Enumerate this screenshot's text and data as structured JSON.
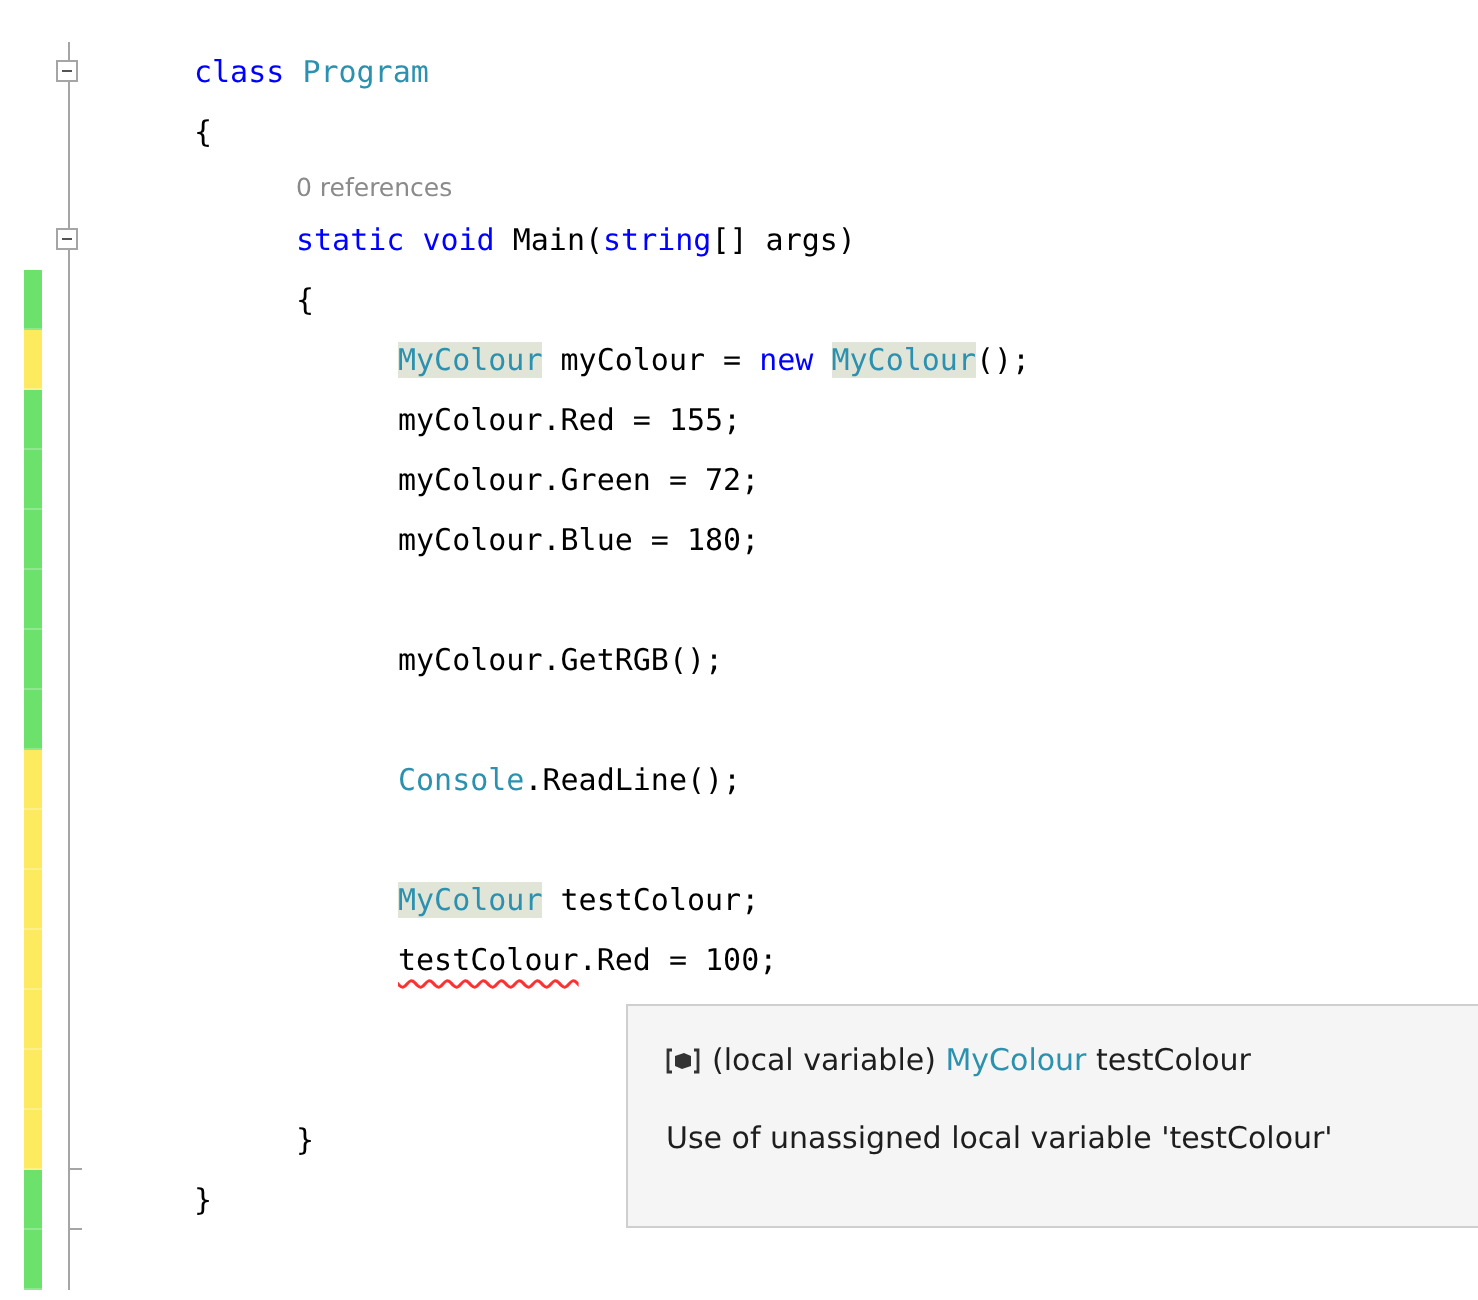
{
  "lines": [
    {
      "kind": "code",
      "expanded": true,
      "tokens": [
        {
          "kind": "keyword",
          "text": "class "
        },
        {
          "kind": "type",
          "text": "Program"
        }
      ]
    },
    {
      "kind": "code",
      "tokens": [
        {
          "kind": "plain",
          "text": "{"
        }
      ],
      "children": [
        {
          "kind": "codelens",
          "text": "0 references"
        },
        {
          "kind": "code",
          "expanded": true,
          "tokens": [
            {
              "kind": "keyword",
              "text": "static "
            },
            {
              "kind": "keyword",
              "text": "void"
            },
            {
              "kind": "plain",
              "text": " Main("
            },
            {
              "kind": "keyword",
              "text": "string"
            },
            {
              "kind": "plain",
              "text": "[] args)"
            }
          ]
        },
        {
          "kind": "code",
          "modified": false,
          "tokens": [
            {
              "kind": "plain",
              "text": "{"
            }
          ],
          "children": [
            {
              "kind": "code",
              "modified": true,
              "tokens": [
                {
                  "kind": "type_highlight",
                  "text": "MyColour"
                },
                {
                  "kind": "plain",
                  "text": " myColour = "
                },
                {
                  "kind": "keyword",
                  "text": "new "
                },
                {
                  "kind": "type_highlight",
                  "text": "MyColour"
                },
                {
                  "kind": "plain",
                  "text": "();"
                }
              ]
            },
            {
              "kind": "code",
              "modified": false,
              "tokens": [
                {
                  "kind": "plain",
                  "text": "myColour.Red = 155;"
                }
              ]
            },
            {
              "kind": "code",
              "modified": false,
              "tokens": [
                {
                  "kind": "plain",
                  "text": "myColour.Green = 72;"
                }
              ]
            },
            {
              "kind": "code",
              "modified": false,
              "tokens": [
                {
                  "kind": "plain",
                  "text": "myColour.Blue = 180;"
                }
              ]
            },
            {
              "kind": "code",
              "modified": false
            },
            {
              "kind": "code",
              "modified": false,
              "tokens": [
                {
                  "kind": "plain",
                  "text": "myColour.GetRGB();"
                }
              ]
            },
            {
              "kind": "code",
              "modified": false
            },
            {
              "kind": "code",
              "modified": true,
              "tokens": [
                {
                  "kind": "type",
                  "text": "Console"
                },
                {
                  "kind": "plain",
                  "text": ".ReadLine();"
                }
              ]
            },
            {
              "kind": "code",
              "modified": true
            },
            {
              "kind": "code",
              "modified": true,
              "tokens": [
                {
                  "kind": "type_highlight",
                  "text": "MyColour"
                },
                {
                  "kind": "plain",
                  "text": " testColour;"
                }
              ]
            },
            {
              "kind": "code",
              "modified": true,
              "tokens": [
                {
                  "kind": "error",
                  "text": "testColour"
                },
                {
                  "kind": "plain",
                  "text": ".Red = 100;"
                }
              ]
            },
            {
              "kind": "code",
              "modified": true
            },
            {
              "kind": "code",
              "modified": true
            }
          ]
        },
        {
          "kind": "code",
          "modified": true,
          "fold_end": true,
          "tokens": [
            {
              "kind": "plain",
              "text": "}"
            }
          ]
        }
      ]
    },
    {
      "kind": "code",
      "modified": false,
      "fold_end": true,
      "tokens": [
        {
          "kind": "plain",
          "text": "}"
        }
      ]
    },
    {
      "kind": "code",
      "modified": false
    }
  ],
  "tooltip": {
    "signature": [
      {
        "kind": "plain",
        "text": "(local variable) "
      },
      {
        "kind": "type",
        "text": "MyColour"
      },
      {
        "kind": "plain",
        "text": " testColour"
      }
    ],
    "message": "Use of unassigned local variable 'testColour'"
  }
}
